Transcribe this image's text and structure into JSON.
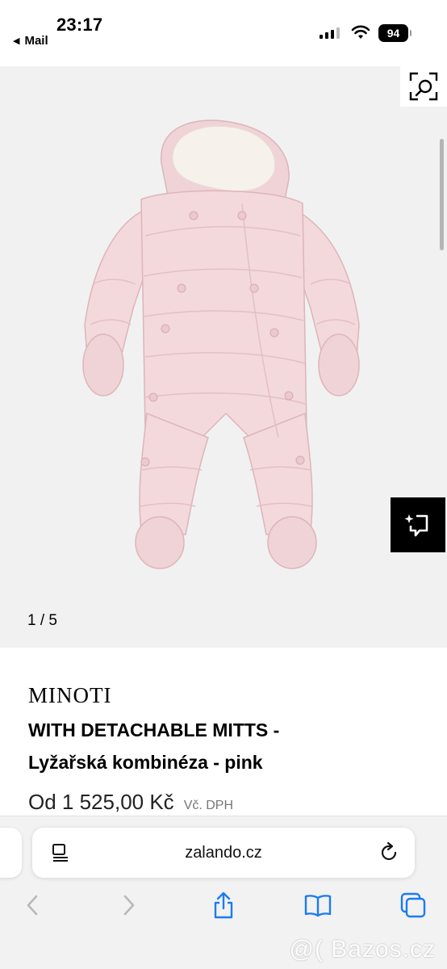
{
  "status_bar": {
    "time": "23:17",
    "back_app": "Mail",
    "battery": "94"
  },
  "gallery": {
    "counter": "1 / 5",
    "image_icon": "pink-snowsuit-image",
    "visual_search_icon": "visual-search-icon",
    "save_look_icon": "save-look-icon"
  },
  "product": {
    "brand": "MINOTI",
    "title_line1": "WITH DETACHABLE MITTS -",
    "title_line2": "Lyžařská kombinéza - pink",
    "price": "Od 1 525,00 Kč",
    "vat": "Vč. DPH"
  },
  "browser": {
    "url": "zalando.cz"
  },
  "watermark": "@( Bazos.cz",
  "colors": {
    "suit": "#f3d9dc",
    "suit_shade": "#e3bfc4",
    "accent_blue": "#1a7cf0",
    "gallery_bg": "#f1f1f1"
  }
}
